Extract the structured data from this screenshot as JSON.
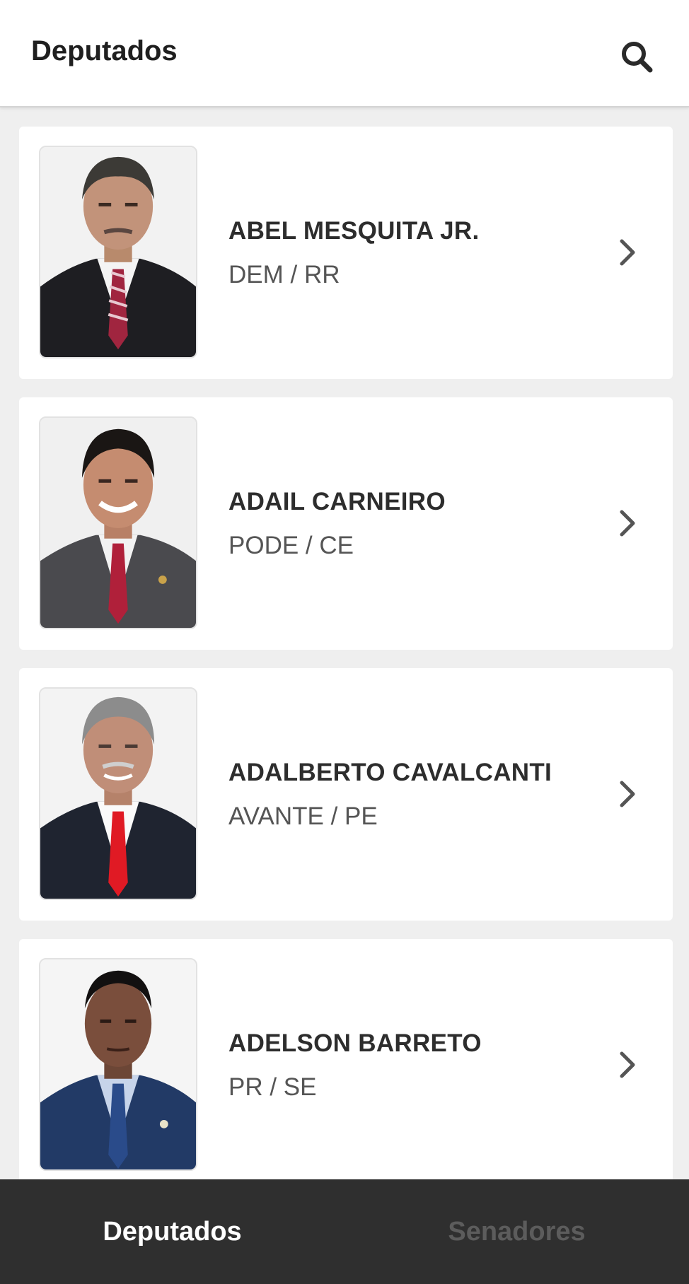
{
  "header": {
    "title": "Deputados",
    "search_icon": "search-icon"
  },
  "deputies": [
    {
      "name": "ABEL MESQUITA JR.",
      "party_state": "DEM / RR",
      "tie_color": "#a0253f"
    },
    {
      "name": "ADAIL CARNEIRO",
      "party_state": "PODE / CE",
      "tie_color": "#b0203a"
    },
    {
      "name": "ADALBERTO CAVALCANTI",
      "party_state": "AVANTE / PE",
      "tie_color": "#e01a24"
    },
    {
      "name": "ADELSON BARRETO",
      "party_state": "PR / SE",
      "tie_color": "#2a4b8a"
    }
  ],
  "tabs": [
    {
      "label": "Deputados",
      "active": true
    },
    {
      "label": "Senadores",
      "active": false
    }
  ],
  "colors": {
    "tab_bar": "#2f2f2f",
    "tab_active": "#ffffff",
    "tab_inactive": "#5c5c5c",
    "background": "#efefef"
  }
}
